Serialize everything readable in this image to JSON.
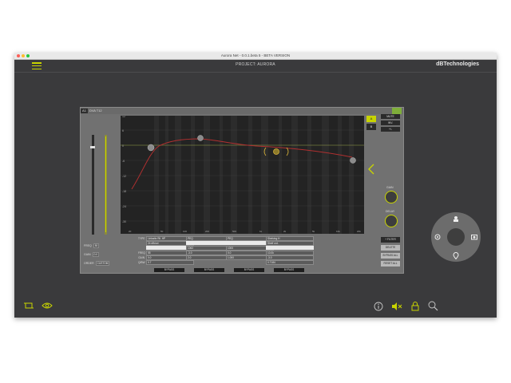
{
  "window": {
    "title": "Aurora Net - 0.0.1.beta 5 - BETA VERSION"
  },
  "header": {
    "project": "PROJECT: AURORA",
    "brand": "dBTechnologies"
  },
  "panel": {
    "badge": "A1",
    "title": "DVA T12"
  },
  "colors": {
    "accent": "#c8d400",
    "background": "#3a3a3c",
    "panel": "#717171",
    "curve": "#b13030"
  },
  "eq": {
    "y_ticks": [
      "12",
      "6",
      "0",
      "-6",
      "-12",
      "-18",
      "-24",
      "-30"
    ],
    "x_ticks": [
      "20",
      "50",
      "100",
      "200",
      "500",
      "1k",
      "2k",
      "5k",
      "10k",
      "20k"
    ],
    "right_buttons": [
      "MUTE",
      "INV.",
      "+/-"
    ],
    "ab_buttons": [
      "A",
      "B"
    ],
    "knob_labels": [
      "GAIN",
      "DELAY"
    ],
    "filter_buttons": [
      "+ FILTER",
      "DELETE",
      "BYPASS ALL",
      "RESET ALL"
    ]
  },
  "left_controls": {
    "rows": [
      {
        "label": "FREQ",
        "value": "50"
      },
      {
        "label": "GAIN",
        "value": "0.0"
      },
      {
        "label": "ORDER",
        "value": "CUSTOM"
      }
    ]
  },
  "bands": [
    {
      "type": "Linkwitz Ril. HP",
      "slope": "24 dB/oct",
      "freq": "55",
      "gain": "0.0",
      "q": "0.7",
      "bypass": "BYPASS"
    },
    {
      "type": "PEQ",
      "slope": "",
      "freq": "1062",
      "gain": "-3.0",
      "q": "2.0",
      "bypass": "BYPASS"
    },
    {
      "type": "PEQ",
      "slope": "",
      "freq": "1000",
      "gain": "0.0",
      "q": "1.000",
      "bypass": "BYPASS"
    },
    {
      "type": "Shelving H",
      "slope": "Shelf ord.",
      "freq": "10.0k",
      "gain": "-3.0",
      "q": "0.7184",
      "bypass": "BYPASS"
    }
  ],
  "band_row_labels": [
    "TYPE",
    "FREQ",
    "GAIN",
    "Q/BW"
  ],
  "toolbar": {
    "left_icons": [
      "crop-icon",
      "eye-icon"
    ],
    "right_icons": [
      "info-icon",
      "mute-icon",
      "lock-icon",
      "zoom-icon"
    ]
  }
}
